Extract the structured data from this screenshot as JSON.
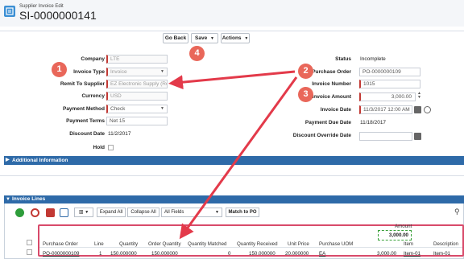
{
  "header": {
    "subtitle": "Supplier Invoice Edit",
    "title": "SI-0000000141"
  },
  "toolbar": {
    "go_back": "Go Back",
    "save": "Save",
    "actions": "Actions"
  },
  "badges": {
    "b1": "1",
    "b2": "2",
    "b3": "3",
    "b4": "4"
  },
  "left_form": {
    "company": {
      "label": "Company",
      "value": "LTE"
    },
    "invoice_type": {
      "label": "Invoice Type",
      "value": "Invoice"
    },
    "remit_to": {
      "label": "Remit To Supplier",
      "value": "EZ Electronic Supply (Remi"
    },
    "currency": {
      "label": "Currency",
      "value": "USD"
    },
    "payment_method": {
      "label": "Payment Method",
      "value": "Check"
    },
    "payment_terms": {
      "label": "Payment Terms",
      "value": "Net 15"
    },
    "discount_date": {
      "label": "Discount Date",
      "value": "11/2/2017"
    },
    "hold": {
      "label": "Hold"
    }
  },
  "right_form": {
    "status": {
      "label": "Status",
      "value": "Incomplete"
    },
    "purchase_order": {
      "label": "Purchase Order",
      "value": "PO-0000000109"
    },
    "invoice_number": {
      "label": "Invoice Number",
      "value": "1015"
    },
    "invoice_amount": {
      "label": "Invoice Amount",
      "value": "3,000.00"
    },
    "invoice_date": {
      "label": "Invoice Date",
      "value": "11/3/2017 12:00 AM"
    },
    "payment_due_date": {
      "label": "Payment Due Date",
      "value": "11/18/2017"
    },
    "discount_override_date": {
      "label": "Discount Override Date",
      "value": ""
    }
  },
  "sections": {
    "additional_information": "Additional Information",
    "invoice_lines": "Invoice Lines"
  },
  "lines_toolbar": {
    "expand_all": "Expand All",
    "collapse_all": "Collapse All",
    "all_fields": "All Fields",
    "match_to_po": "Match to PO"
  },
  "table": {
    "amount_header": "Amount",
    "amount_total": "3,000.00",
    "columns": [
      "Purchase Order",
      "Line",
      "Quantity",
      "Order Quantity",
      "Quantity Matched",
      "Quantity Received",
      "Unit Price",
      "Purchase UOM",
      "",
      "Item",
      "Description"
    ],
    "rows": [
      [
        "PO-0000000109",
        "1",
        "150.000000",
        "150.000000",
        "0",
        "150.000000",
        "20.000000",
        "EA",
        "3,000.00",
        "Item-01",
        "Item-01"
      ]
    ]
  },
  "colors": {
    "accent_blue": "#2e6aa8",
    "badge_red": "#e9675a",
    "highlight": "#d84a6a",
    "required": "#c23934"
  }
}
